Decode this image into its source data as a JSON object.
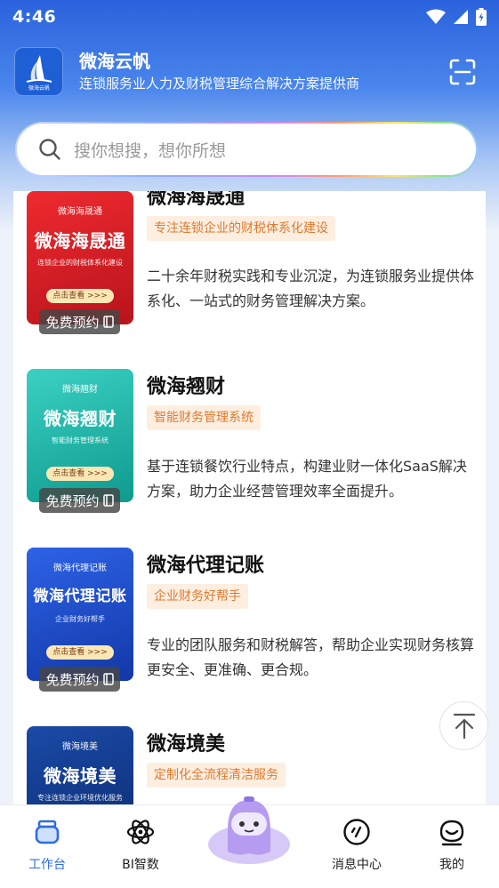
{
  "status_bar": {
    "time": "4:46"
  },
  "app": {
    "logo_text": "微海云帆",
    "name": "微海云帆",
    "subtitle": "连锁服务业人力及财税管理综合解决方案提供商"
  },
  "search": {
    "placeholder": "搜你想搜，想你所想"
  },
  "items": [
    {
      "title": "微海海晟通",
      "tag": "专注连锁企业的财税体系化建设",
      "desc": "二十余年财税实践和专业沉淀，为连锁服务业提供体系化、一站式的财务管理解决方案。",
      "thumb_brand": "微海海晟通",
      "thumb_title": "微海海晟通",
      "thumb_sub": "连锁企业的财税体系化建设",
      "thumb_btn": "点击查看 >>>",
      "badge": "免费预约",
      "color": "#d8202a"
    },
    {
      "title": "微海翘财",
      "tag": "智能财务管理系统",
      "desc": "基于连锁餐饮行业特点，构建业财一体化SaaS解决方案，助力企业经营管理效率全面提升。",
      "thumb_brand": "微海翘财",
      "thumb_title": "微海翘财",
      "thumb_sub": "智能财务管理系统",
      "thumb_btn": "点击查看 >>>",
      "badge": "免费预约",
      "color": "#20b2a4"
    },
    {
      "title": "微海代理记账",
      "tag": "企业财务好帮手",
      "desc": "专业的团队服务和财税解答，帮助企业实现财务核算更安全、更准确、更合规。",
      "thumb_brand": "微海代理记账",
      "thumb_title": "微海代理记账",
      "thumb_sub": "企业财务好帮手",
      "thumb_btn": "点击查看 >>>",
      "badge": "免费预约",
      "color": "#1c4fd0"
    },
    {
      "title": "微海境美",
      "tag": "定制化全流程清洁服务",
      "thumb_brand": "微海境美",
      "thumb_title": "微海境美",
      "thumb_sub": "专注连锁企业环境优化服务",
      "color": "#123a8a"
    }
  ],
  "tabs": [
    {
      "label": "工作台",
      "icon": "workbench-icon",
      "active": true
    },
    {
      "label": "BI智数",
      "icon": "atom-icon"
    },
    {
      "label": "",
      "icon": "mascot-icon"
    },
    {
      "label": "消息中心",
      "icon": "message-icon"
    },
    {
      "label": "我的",
      "icon": "profile-icon"
    }
  ],
  "colors": {
    "accent": "#2f6de0",
    "tag_bg": "#fdeee0",
    "tag_text": "#e07a2e"
  }
}
